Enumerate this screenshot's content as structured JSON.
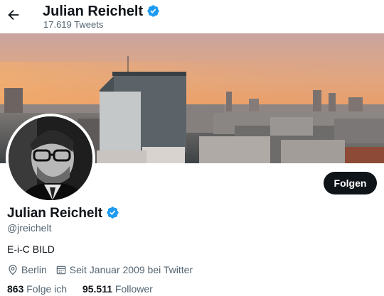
{
  "header": {
    "name": "Julian Reichelt",
    "tweet_count": "17.619 Tweets",
    "back_icon": "arrow-left-icon"
  },
  "profile": {
    "name": "Julian Reichelt",
    "handle": "@jreichelt",
    "bio": "E-i-C BILD",
    "location": "Berlin",
    "joined": "Seit Januar 2009 bei Twitter",
    "verified": true
  },
  "follow_button": {
    "label": "Folgen"
  },
  "stats": {
    "following_count": "863",
    "following_label": "Folge ich",
    "followers_count": "95.511",
    "followers_label": "Follower"
  },
  "colors": {
    "verified_blue": "#1d9bf0",
    "text": "#0f1419",
    "secondary_text": "#536471",
    "button_bg": "#0f1419"
  }
}
